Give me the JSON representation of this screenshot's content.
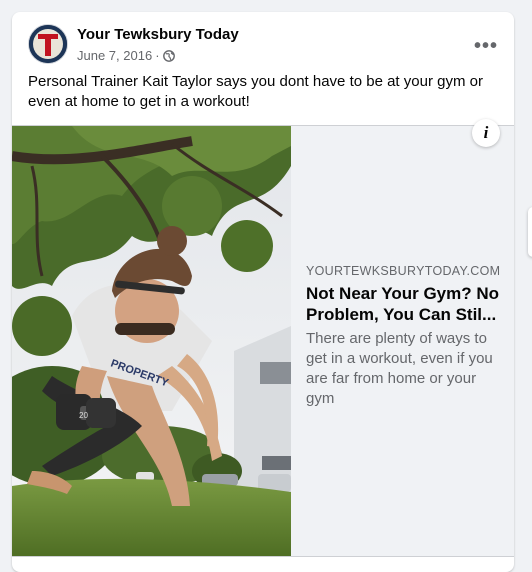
{
  "post": {
    "page_name": "Your Tewksbury Today",
    "date": "June 7, 2016",
    "separator": "·",
    "privacy_icon": "globe-icon",
    "more_icon": "more-options-icon",
    "more_label": "•••",
    "avatar_letter": "T",
    "text": "Personal Trainer Kait Taylor says you dont have to be at your gym or even at home to get in a workout!"
  },
  "link": {
    "domain": "YOURTEWKSBURYTODAY.COM",
    "title": "Not Near Your Gym? No Problem, You Can Stil...",
    "description": "There are plenty of ways to get in a workout, even if you are far from home or your gym",
    "info_label": "i",
    "photo": {
      "shirt_text": "PROPERTY",
      "dumbbell_text": "20"
    }
  },
  "colors": {
    "background": "#f0f2f5",
    "card": "#ffffff",
    "primary_text": "#050505",
    "secondary_text": "#65676b",
    "avatar_bg": "#1d3557",
    "avatar_accent": "#c1121f"
  }
}
